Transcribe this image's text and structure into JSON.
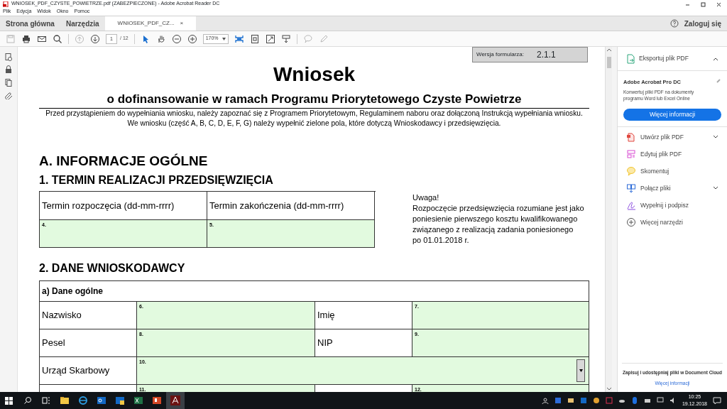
{
  "window": {
    "title": "WNIOSEK_PDF_CZYSTE_POWIETRZE.pdf (ZABEZPIECZONE) - Adobe Acrobat Reader DC"
  },
  "menu": [
    "Plik",
    "Edycja",
    "Widok",
    "Okno",
    "Pomoc"
  ],
  "tabs": [
    {
      "label": "Strona główna",
      "selected": false
    },
    {
      "label": "Narzędzia",
      "selected": false
    },
    {
      "label": "WNIOSEK_PDF_CZ...",
      "selected": true,
      "close": "×"
    }
  ],
  "signin": "Zaloguj się",
  "toolbar": [
    {
      "kind": "save",
      "disabled": true
    },
    {
      "kind": "print",
      "disabled": false
    },
    {
      "kind": "mail",
      "disabled": false
    },
    {
      "kind": "search",
      "disabled": false
    },
    {
      "kind": "sep"
    },
    {
      "kind": "up",
      "disabled": true
    },
    {
      "kind": "down",
      "disabled": false
    },
    {
      "kind": "page",
      "value": "1",
      "total": "/ 12"
    },
    {
      "kind": "sep"
    },
    {
      "kind": "pointer",
      "disabled": false
    },
    {
      "kind": "hand",
      "disabled": false
    },
    {
      "kind": "zoomout",
      "disabled": false
    },
    {
      "kind": "zoomin",
      "disabled": false
    },
    {
      "kind": "zoom",
      "value": "170%"
    },
    {
      "kind": "fit",
      "disabled": false
    },
    {
      "kind": "fitpage",
      "disabled": false
    },
    {
      "kind": "full",
      "disabled": false
    },
    {
      "kind": "scroll",
      "disabled": false
    },
    {
      "kind": "sep"
    },
    {
      "kind": "comment",
      "disabled": true
    },
    {
      "kind": "pen",
      "disabled": true
    }
  ],
  "document": {
    "version_label": "Wersja formularza:",
    "version": "2.1.1",
    "title": "Wniosek",
    "subtitle": "o dofinansowanie w ramach Programu Priorytetowego Czyste Powietrze",
    "intro": "Przed przystąpieniem do wypełniania wniosku, należy zapoznać się z Programem Priorytetowym, Regulaminem naboru oraz dołączoną Instrukcją wypełniania wniosku. We wniosku (część A, B, C, D, E, F, G) należy wypełnić zielone pola, które dotyczą Wnioskodawcy i przedsięwzięcia.",
    "section_a": "A. INFORMACJE OGÓLNE",
    "section_1": "1. TERMIN REALIZACJI PRZEDSIĘWZIĘCIA",
    "term_table": {
      "headers": [
        "Termin rozpoczęcia (dd-mm-rrrr)",
        "Termin zakończenia (dd-mm-rrrr)"
      ],
      "fields": [
        "4.",
        "5."
      ]
    },
    "note": [
      "Uwaga!",
      "Rozpoczęcie przedsięwzięcia rozumiane jest jako",
      "poniesienie pierwszego kosztu kwalifikowanego",
      "związanego z realizacją zadania poniesionego",
      "po 01.01.2018 r."
    ],
    "section_2": "2. DANE WNIOSKODAWCY",
    "applicant_table": {
      "heading": "a) Dane ogólne",
      "rows": [
        {
          "kind": "pair",
          "cells": [
            {
              "label": "Nazwisko",
              "field": "6."
            },
            {
              "label": "Imię",
              "field": "7."
            }
          ]
        },
        {
          "kind": "pair",
          "cells": [
            {
              "label": "Pesel",
              "field": "8."
            },
            {
              "label": "NIP",
              "field": "9."
            }
          ]
        },
        {
          "kind": "select",
          "cells": [
            {
              "label": "Urząd Skarbowy",
              "field": "10."
            }
          ]
        },
        {
          "kind": "pair",
          "cells": [
            {
              "field": "11."
            },
            {
              "field": "12."
            }
          ]
        }
      ]
    }
  },
  "right_pane": {
    "export": {
      "label": "Eksportuj plik PDF",
      "expanded": true
    },
    "promo_title": "Adobe Acrobat Pro DC",
    "promo_text": "Konwertuj pliki PDF na dokumenty programu Word lub Excel Online",
    "promo_button": "Więcej informacji",
    "tools": [
      {
        "kind": "create",
        "label": "Utwórz plik PDF",
        "expandable": true
      },
      {
        "kind": "edit",
        "label": "Edytuj plik PDF",
        "expandable": false
      },
      {
        "kind": "comment",
        "label": "Skomentuj",
        "expandable": false
      },
      {
        "kind": "combine",
        "label": "Połącz pliki",
        "expandable": true
      },
      {
        "kind": "sign",
        "label": "Wypełnij i podpisz",
        "expandable": false
      },
      {
        "kind": "more",
        "label": "Więcej narzędzi",
        "expandable": false
      }
    ],
    "footer_text": "Zapisuj i udostępniaj pliki w Document Cloud",
    "footer_link": "Więcej informacji"
  },
  "taskbar": {
    "time": "10:25",
    "date": "19.12.2018"
  }
}
